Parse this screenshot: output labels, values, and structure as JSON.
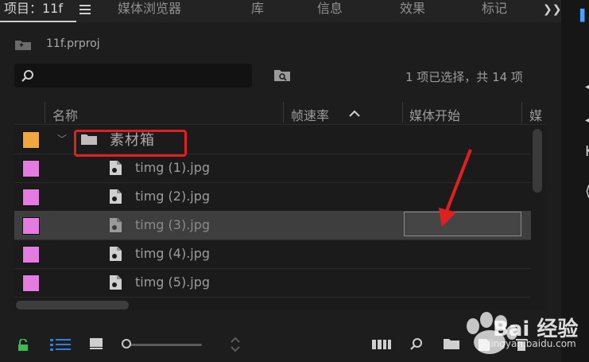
{
  "tabs": [
    {
      "label": "项目：11f"
    },
    {
      "label": "媒体浏览器"
    },
    {
      "label": "库"
    },
    {
      "label": "信息"
    },
    {
      "label": "效果"
    },
    {
      "label": "标记"
    }
  ],
  "breadcrumb": {
    "project_name": "11f.prproj"
  },
  "search": {
    "placeholder": "",
    "value": ""
  },
  "selection_status": "1 项已选择，共 14 项",
  "columns": [
    "名称",
    "帧速率",
    "媒体开始",
    "媒"
  ],
  "folder": {
    "name": "素材箱",
    "label_color": "#f0a73d",
    "expanded": true
  },
  "files": [
    {
      "name": "timg (1).jpg",
      "label_color": "#e47be0",
      "selected": false
    },
    {
      "name": "timg (2).jpg",
      "label_color": "#e47be0",
      "selected": false
    },
    {
      "name": "timg (3).jpg",
      "label_color": "#e47be0",
      "selected": true
    },
    {
      "name": "timg (4).jpg",
      "label_color": "#e47be0",
      "selected": false
    },
    {
      "name": "timg (5).jpg",
      "label_color": "#e47be0",
      "selected": false
    }
  ],
  "icons": {
    "menu": "hamburger-menu-icon",
    "more": "double-chevron-right-icon",
    "project": "project-folder-icon",
    "search": "magnifier-icon",
    "new_bin": "new-bin-icon",
    "sort": "sort-ascending-icon",
    "lock": "lock-icon",
    "list_view": "list-view-icon",
    "icon_view": "icon-view-icon",
    "freeform": "freeform-view-icon",
    "find": "find-icon",
    "new_item": "new-item-icon",
    "delete": "trash-icon"
  },
  "colors": {
    "accent_blue": "#2e7fd6",
    "lock_green": "#3cba54",
    "annotation_red": "#e02020"
  },
  "watermark": {
    "line1": "Bai 经验",
    "line2": "jingyan.baidu.com"
  }
}
